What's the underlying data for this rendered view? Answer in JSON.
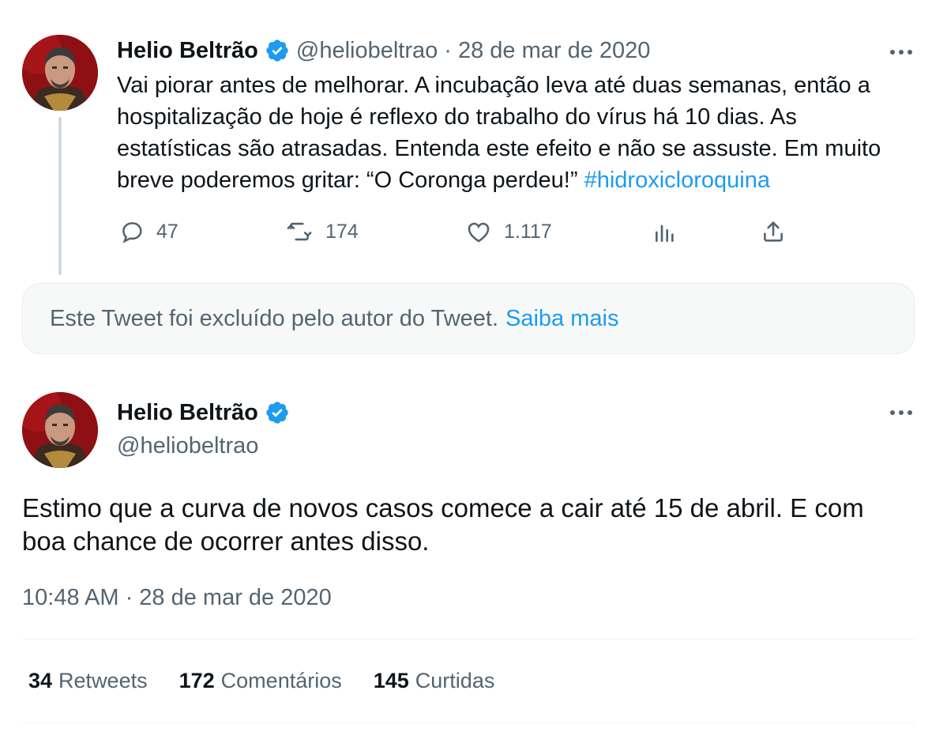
{
  "quoted_tweet": {
    "author_name": "Helio Beltrão",
    "handle": "@heliobeltrao",
    "separator": "·",
    "date": "28 de mar de 2020",
    "text": "Vai piorar antes de melhorar.  A incubação leva até duas semanas, então a hospitalização de hoje é reflexo do trabalho do vírus há 10 dias. As estatísticas são atrasadas. Entenda este efeito e não se assuste. Em muito breve poderemos gritar: “O Coronga perdeu!” ",
    "hashtag": "#hidroxicloroquina",
    "actions": {
      "replies": "47",
      "retweets": "174",
      "likes": "1.117"
    }
  },
  "deleted_notice": {
    "text": "Este Tweet foi excluído pelo autor do Tweet.",
    "link": "Saiba mais"
  },
  "main_tweet": {
    "author_name": "Helio Beltrão",
    "handle": "@heliobeltrao",
    "text": "Estimo que a curva de novos casos comece a cair até 15 de abril.  E com boa chance de ocorrer antes disso.",
    "timestamp": "10:48 AM · 28 de mar de 2020",
    "stats": {
      "retweets_count": "34",
      "retweets_label": "Retweets",
      "comments_count": "172",
      "comments_label": "Comentários",
      "likes_count": "145",
      "likes_label": "Curtidas"
    }
  },
  "colors": {
    "text": "#0f1419",
    "secondary": "#536471",
    "accent": "#1d9bf0",
    "verified": "#1d9bf0",
    "thread_line": "#cfd9de"
  },
  "icons": [
    "verified-badge-icon",
    "more-icon",
    "reply-icon",
    "retweet-icon",
    "like-icon",
    "analytics-icon",
    "share-icon"
  ]
}
